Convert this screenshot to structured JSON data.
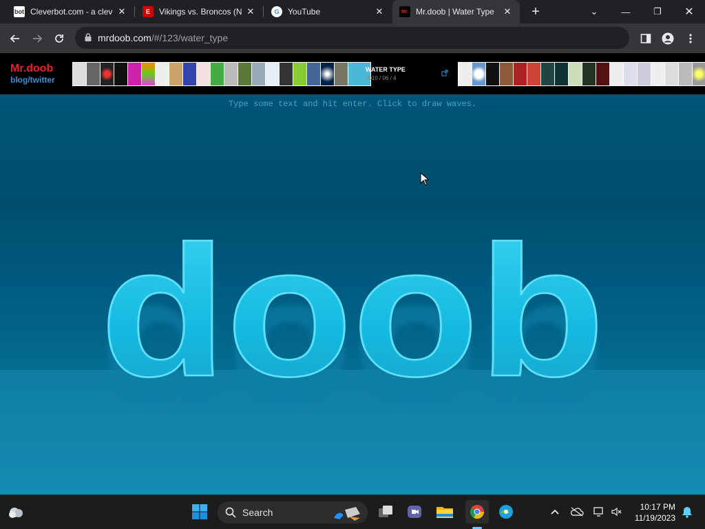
{
  "tabs": [
    {
      "title": "Cleverbot.com - a clev",
      "favicon": "cleverbot-favicon-icon",
      "fav_text": "bot"
    },
    {
      "title": "Vikings vs. Broncos (N",
      "favicon": "espn-favicon-icon",
      "fav_text": "E"
    },
    {
      "title": "YouTube",
      "favicon": "google-favicon-icon",
      "fav_text": "G"
    },
    {
      "title": "Mr.doob | Water Type",
      "favicon": "mrdoob-favicon-icon",
      "fav_text": "Mr."
    }
  ],
  "address": {
    "host": "mrdoob.com",
    "path": "/#/123/water_type"
  },
  "site": {
    "logo_line1": "Mr.doob",
    "logo_line2": "blog/twitter",
    "experiment_title": "WATER TYPE",
    "experiment_date": "2010 / 06 / 4",
    "instruction": "Type some text and hit enter. Click to draw waves."
  },
  "water_text": "doob",
  "taskbar": {
    "search_label": "Search",
    "time": "10:17 PM",
    "date": "11/19/2023"
  },
  "colors": {
    "water_deep": "#004f6e",
    "water_text": "#19c4e6",
    "logo_red": "#e8202e",
    "logo_blue": "#3a8fd8",
    "instruction": "#3aa7c9"
  }
}
